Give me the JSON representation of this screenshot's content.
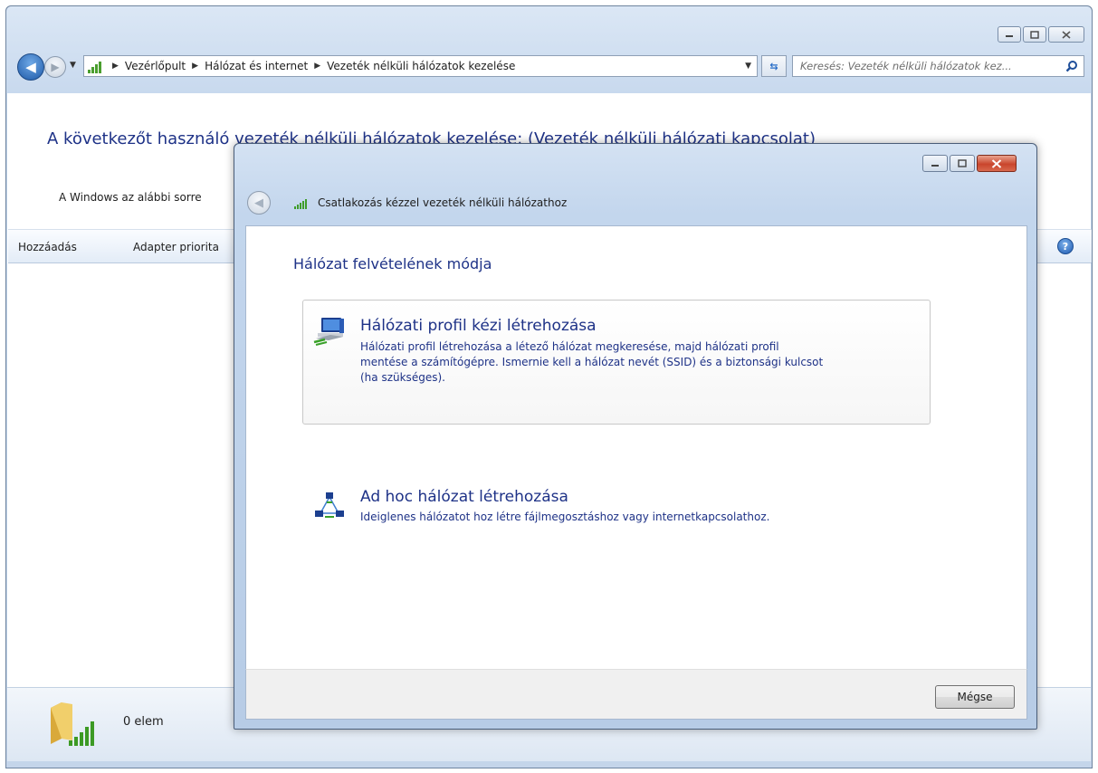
{
  "main_window": {
    "breadcrumbs": [
      "Vezérlőpult",
      "Hálózat és internet",
      "Vezeték nélküli hálózatok kezelése"
    ],
    "search_placeholder": "Keresés: Vezeték nélküli hálózatok kez...",
    "page_title": "A következőt használó vezeték nélküli hálózatok kezelése: (Vezeték nélküli hálózati kapcsolat)",
    "page_description": "A Windows az alábbi sorre",
    "toolbar": {
      "add_label": "Hozzáadás",
      "adapter_label": "Adapter priorita"
    },
    "status_bar": {
      "item_count": "0 elem"
    }
  },
  "dialog": {
    "title": "Csatlakozás kézzel vezeték nélküli hálózathoz",
    "heading": "Hálózat felvételének módja",
    "options": [
      {
        "title": "Hálózati profil kézi létrehozása",
        "description_lines": [
          "Hálózati profil létrehozása a létező hálózat megkeresése, majd hálózati profil",
          "mentése a számítógépre. Ismernie kell a hálózat nevét (SSID) és a biztonsági kulcsot",
          "(ha szükséges)."
        ],
        "selected": true
      },
      {
        "title": "Ad hoc hálózat létrehozása",
        "description_lines": [
          "Ideiglenes hálózatot hoz létre fájlmegosztáshoz vagy internetkapcsolathoz."
        ],
        "selected": false
      }
    ],
    "cancel_label": "Mégse"
  },
  "icons": {
    "nav_back": "back-arrow-icon",
    "nav_forward": "forward-arrow-icon",
    "address": "network-signal-icon",
    "refresh": "refresh-icon",
    "search": "search-icon",
    "help": "help-icon",
    "status": "wireless-folder-icon",
    "profile_option": "computer-network-icon",
    "adhoc_option": "adhoc-network-icon"
  },
  "colors": {
    "link_blue": "#1e3287",
    "signal_green": "#3f9d2a",
    "close_red": "#c9452c"
  }
}
